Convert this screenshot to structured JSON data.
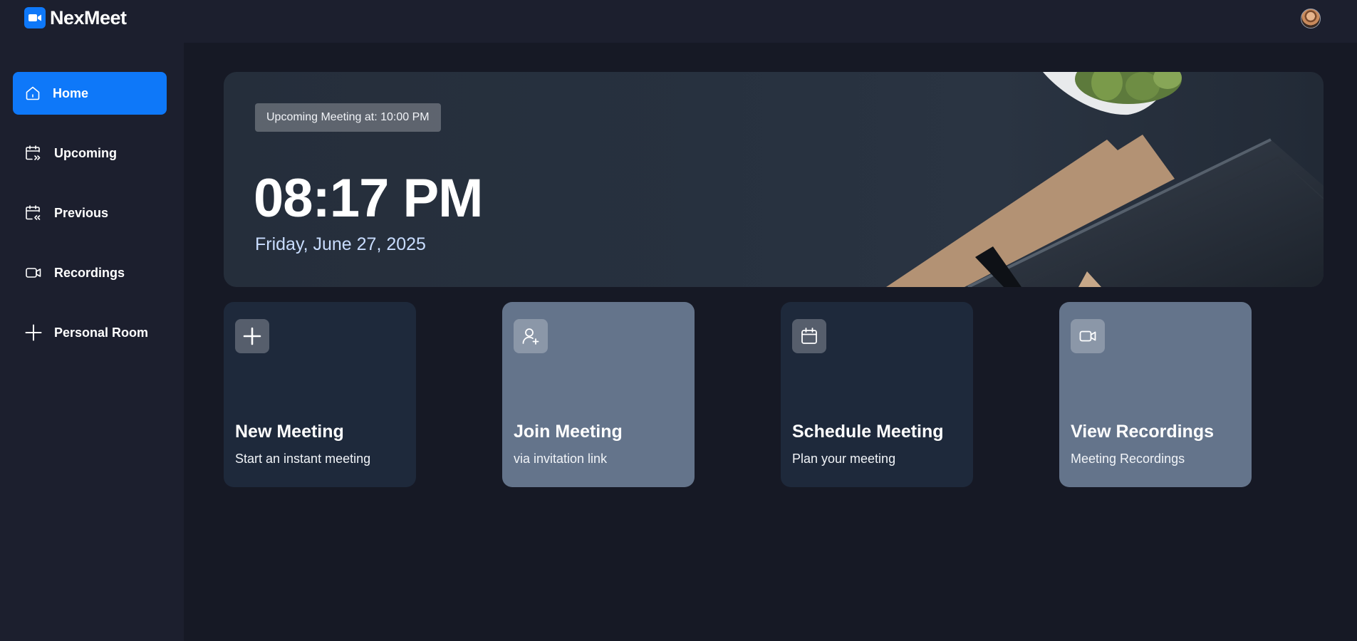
{
  "app": {
    "name": "NexMeet"
  },
  "colors": {
    "accent": "#0e78f9",
    "background": "#161925",
    "panel": "#1c1f2e",
    "card_dark": "#1e293b",
    "card_light": "#64748b"
  },
  "header": {
    "logo_icon": "video-camera-icon",
    "avatar": "user-avatar"
  },
  "sidebar": {
    "items": [
      {
        "label": "Home",
        "icon": "home-icon",
        "active": true
      },
      {
        "label": "Upcoming",
        "icon": "calendar-forward-icon",
        "active": false
      },
      {
        "label": "Previous",
        "icon": "calendar-back-icon",
        "active": false
      },
      {
        "label": "Recordings",
        "icon": "video-icon",
        "active": false
      },
      {
        "label": "Personal Room",
        "icon": "plus-icon",
        "active": false
      }
    ]
  },
  "hero": {
    "badge": "Upcoming Meeting at: 10:00 PM",
    "time": "08:17 PM",
    "date": "Friday, June 27, 2025"
  },
  "cards": [
    {
      "title": "New Meeting",
      "subtitle": "Start an instant meeting",
      "icon": "plus-icon"
    },
    {
      "title": "Join Meeting",
      "subtitle": "via invitation link",
      "icon": "user-plus-icon"
    },
    {
      "title": "Schedule Meeting",
      "subtitle": "Plan your meeting",
      "icon": "calendar-icon"
    },
    {
      "title": "View Recordings",
      "subtitle": "Meeting Recordings",
      "icon": "video-icon"
    }
  ]
}
